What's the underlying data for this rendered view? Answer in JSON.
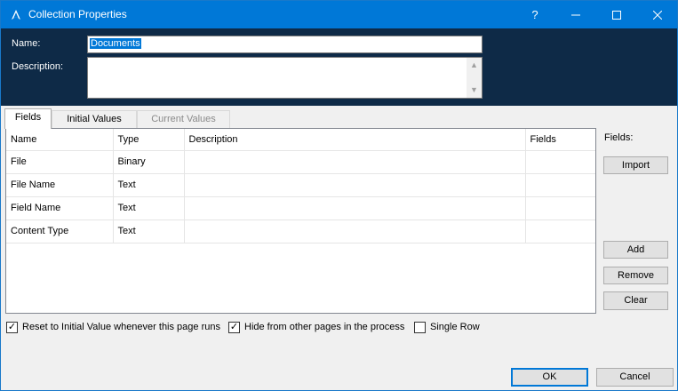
{
  "window": {
    "title": "Collection Properties",
    "help_glyph": "?",
    "minimize_glyph": "—",
    "maximize_glyph": "☐",
    "close_glyph": "✕",
    "accent_color": "#0078d7",
    "header_color": "#0e2a47"
  },
  "form": {
    "name_label": "Name:",
    "name_value": "Documents",
    "description_label": "Description:",
    "description_value": ""
  },
  "tabs": [
    {
      "label": "Fields",
      "active": true
    },
    {
      "label": "Initial Values",
      "active": false
    },
    {
      "label": "Current Values",
      "active": false,
      "disabled": true
    }
  ],
  "grid": {
    "columns": [
      "Name",
      "Type",
      "Description",
      "Fields"
    ],
    "rows": [
      {
        "name": "File",
        "type": "Binary",
        "description": "",
        "fields": ""
      },
      {
        "name": "File Name",
        "type": "Text",
        "description": "",
        "fields": ""
      },
      {
        "name": "Field Name",
        "type": "Text",
        "description": "",
        "fields": ""
      },
      {
        "name": "Content Type",
        "type": "Text",
        "description": "",
        "fields": ""
      }
    ]
  },
  "side": {
    "fields_label": "Fields:",
    "import_label": "Import",
    "add_label": "Add",
    "remove_label": "Remove",
    "clear_label": "Clear"
  },
  "options": {
    "reset_label": "Reset to Initial Value whenever this page runs",
    "reset_checked": true,
    "hide_label": "Hide from other pages in the process",
    "hide_checked": true,
    "single_row_label": "Single Row",
    "single_row_checked": false
  },
  "footer": {
    "ok_label": "OK",
    "cancel_label": "Cancel"
  }
}
